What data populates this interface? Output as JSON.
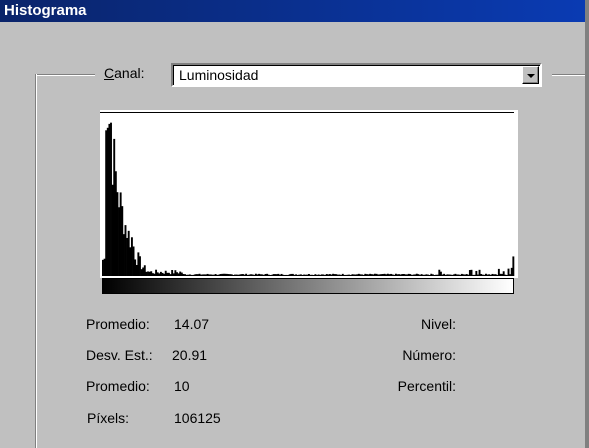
{
  "window": {
    "title": "Histograma"
  },
  "channel": {
    "label": "Canal:",
    "mnemonic": "C",
    "label_rest": "anal:",
    "value": "Luminosidad"
  },
  "histogram": {
    "note_values_are_relative_counts_per_level_0_to_1": true,
    "levels": 256,
    "peak_region": "dark"
  },
  "stats": {
    "mean_label": "Promedio:",
    "mean_value": "14.07",
    "stddev_label": "Desv. Est.:",
    "stddev_value": "20.91",
    "median_label": "Promedio:",
    "median_value": "10",
    "pixels_label": "Píxels:",
    "pixels_value": "106125",
    "level_label": "Nivel:",
    "count_label": "Número:",
    "percentile_label": "Percentil:"
  },
  "colors": {
    "face": "#c0c0c0",
    "title_bar": "#0a246a",
    "title_text": "#ffffff"
  }
}
